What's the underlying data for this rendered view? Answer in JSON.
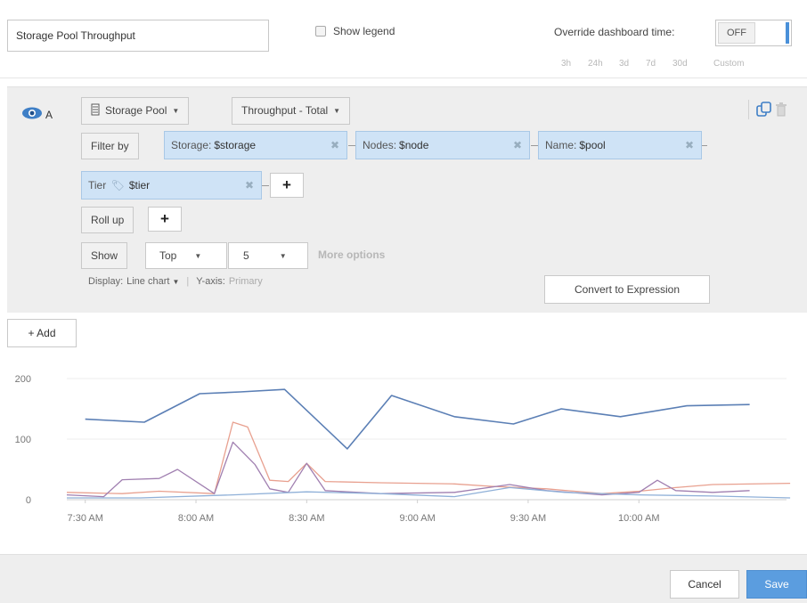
{
  "header": {
    "title_value": "Storage Pool Throughput",
    "show_legend_label": "Show legend",
    "override_label": "Override dashboard time:",
    "override_toggle_state": "OFF",
    "time_ranges": [
      "3h",
      "24h",
      "3d",
      "7d",
      "30d",
      "Custom"
    ]
  },
  "query": {
    "letter": "A",
    "object_type": "Storage Pool",
    "metric": "Throughput - Total",
    "filter_by_label": "Filter by",
    "filters": [
      {
        "key": "Storage:",
        "value": "$storage"
      },
      {
        "key": "Nodes:",
        "value": "$node"
      },
      {
        "key": "Name:",
        "value": "$pool"
      },
      {
        "key": "Tier",
        "value": "$tier"
      }
    ],
    "roll_up_label": "Roll up",
    "show_label": "Show",
    "show_mode": "Top",
    "show_count": "5",
    "more_options": "More options",
    "display_label": "Display:",
    "display_value": "Line chart",
    "yaxis_label": "Y-axis:",
    "yaxis_value": "Primary",
    "convert_button": "Convert to Expression"
  },
  "add_button": "+ Add",
  "footer": {
    "cancel": "Cancel",
    "save": "Save"
  },
  "colors": {
    "accent": "#5b9ddf",
    "chip_bg": "#cfe3f6",
    "series_1": "#5b7fb5",
    "series_2": "#e8a08f",
    "series_3": "#a07fb0",
    "series_4": "#8fb0d8"
  },
  "chart_data": {
    "type": "line",
    "x_tick_labels": [
      "7:30 AM",
      "8:00 AM",
      "8:30 AM",
      "9:00 AM",
      "9:30 AM",
      "10:00 AM"
    ],
    "y_tick_labels": [
      "0",
      "100",
      "200"
    ],
    "ylim": [
      0,
      200
    ],
    "x_minutes_range": [
      445,
      640
    ],
    "grid": true,
    "series": [
      {
        "color": "#5b7fb5",
        "points": [
          [
            450,
            133
          ],
          [
            466,
            128
          ],
          [
            481,
            175
          ],
          [
            492,
            178
          ],
          [
            504,
            182
          ],
          [
            521,
            84
          ],
          [
            533,
            172
          ],
          [
            550,
            137
          ],
          [
            566,
            125
          ],
          [
            579,
            150
          ],
          [
            595,
            137
          ],
          [
            613,
            155
          ],
          [
            630,
            157
          ]
        ]
      },
      {
        "color": "#e8a08f",
        "points": [
          [
            445,
            12
          ],
          [
            460,
            10
          ],
          [
            470,
            14
          ],
          [
            485,
            10
          ],
          [
            490,
            128
          ],
          [
            494,
            120
          ],
          [
            500,
            32
          ],
          [
            505,
            30
          ],
          [
            510,
            60
          ],
          [
            515,
            30
          ],
          [
            530,
            28
          ],
          [
            550,
            26
          ],
          [
            560,
            22
          ],
          [
            575,
            18
          ],
          [
            590,
            10
          ],
          [
            600,
            14
          ],
          [
            610,
            20
          ],
          [
            620,
            25
          ],
          [
            641,
            27
          ]
        ]
      },
      {
        "color": "#a07fb0",
        "points": [
          [
            445,
            8
          ],
          [
            455,
            5
          ],
          [
            460,
            33
          ],
          [
            470,
            35
          ],
          [
            475,
            50
          ],
          [
            485,
            10
          ],
          [
            490,
            95
          ],
          [
            496,
            58
          ],
          [
            500,
            18
          ],
          [
            505,
            12
          ],
          [
            510,
            60
          ],
          [
            515,
            15
          ],
          [
            530,
            10
          ],
          [
            550,
            12
          ],
          [
            565,
            25
          ],
          [
            575,
            15
          ],
          [
            590,
            8
          ],
          [
            600,
            12
          ],
          [
            605,
            32
          ],
          [
            610,
            15
          ],
          [
            620,
            12
          ],
          [
            630,
            15
          ]
        ]
      },
      {
        "color": "#8fb0d8",
        "points": [
          [
            445,
            3
          ],
          [
            465,
            3
          ],
          [
            490,
            8
          ],
          [
            510,
            13
          ],
          [
            530,
            10
          ],
          [
            550,
            5
          ],
          [
            565,
            20
          ],
          [
            580,
            12
          ],
          [
            600,
            8
          ],
          [
            620,
            6
          ],
          [
            641,
            3
          ]
        ]
      }
    ]
  }
}
